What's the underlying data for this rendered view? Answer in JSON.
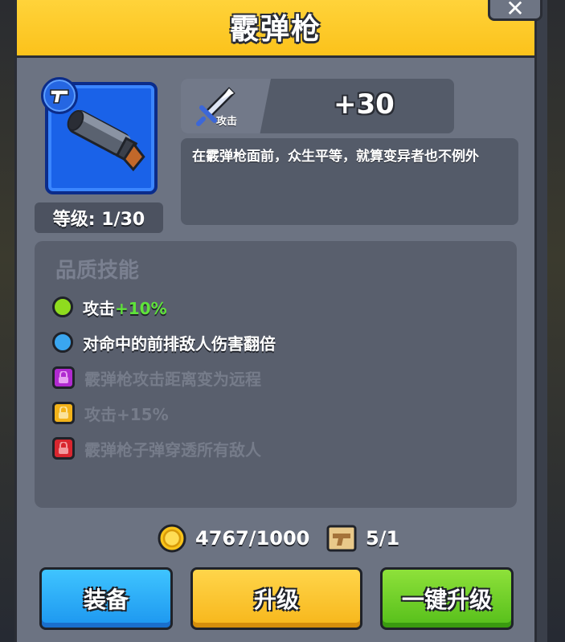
{
  "header": {
    "title": "霰弹枪",
    "close_icon": "close-icon"
  },
  "weapon": {
    "icon": "shotgun-icon",
    "tag_icon": "pistol-tag-icon",
    "level_label": "等级: 1/30",
    "card_color": "#1a62e8"
  },
  "stat": {
    "icon": "sword-icon",
    "icon_label": "攻击",
    "value": "+30"
  },
  "description": "在霰弹枪面前，众生平等，就算变异者也不例外",
  "skills": {
    "title": "品质技能",
    "items": [
      {
        "prefix": "攻击",
        "highlight": "+10%",
        "marker": "green-dot",
        "color": "#8fdc1e",
        "locked": false
      },
      {
        "prefix": "对命中的前排敌人伤害翻倍",
        "highlight": "",
        "marker": "blue-dot",
        "color": "#3aa6f0",
        "locked": false
      },
      {
        "prefix": "霰弹枪攻击距离变为远程",
        "highlight": "",
        "marker": "purple-lock",
        "color": "#b02ad0",
        "locked": true
      },
      {
        "prefix": "攻击+15%",
        "highlight": "",
        "marker": "orange-lock",
        "color": "#f3b31a",
        "locked": true
      },
      {
        "prefix": "霰弹枪子弹穿透所有敌人",
        "highlight": "",
        "marker": "red-lock",
        "color": "#d9262f",
        "locked": true
      }
    ]
  },
  "resources": {
    "coins": {
      "icon": "coin-icon",
      "value": "4767/1000"
    },
    "blueprint": {
      "icon": "blueprint-icon",
      "value": "5/1"
    }
  },
  "buttons": {
    "equip": "装备",
    "upgrade": "升级",
    "one_click_upgrade": "一键升级"
  }
}
